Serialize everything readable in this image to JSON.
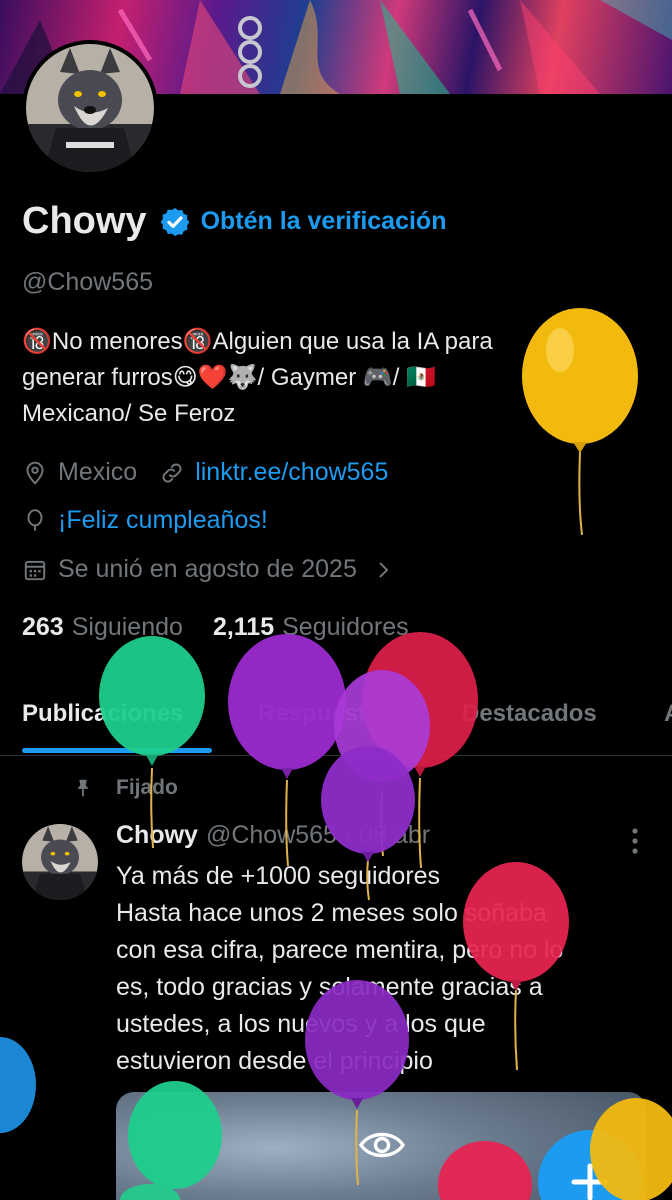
{
  "profile": {
    "name": "Chowy",
    "get_verified": "Obtén la verificación",
    "handle": "@Chow565",
    "bio_lines": [
      "🔞No menores🔞Alguien que usa la IA para",
      "generar furros😋❤️🐺/ Gaymer 🎮/ 🇲🇽",
      "Mexicano/ Se Feroz"
    ],
    "location": "Mexico",
    "link": "linktr.ee/chow565",
    "birthday": "¡Feliz cumpleaños!",
    "joined": "Se unió en agosto de 2025"
  },
  "stats": {
    "following_count": "263",
    "following_label": "Siguiendo",
    "followers_count": "2,115",
    "followers_label": "Seguidores"
  },
  "tabs": [
    {
      "label": "Publicaciones",
      "active": true
    },
    {
      "label": "Respuestas",
      "active": false
    },
    {
      "label": "Destacados",
      "active": false
    },
    {
      "label": "A",
      "active": false
    }
  ],
  "pinned_label": "Fijado",
  "post": {
    "name": "Chowy",
    "handle_time": "@Chow565 · 08 abr",
    "text_lines": [
      "Ya más de +1000 seguidores",
      "Hasta hace unos 2 meses solo soñaba",
      "con esa cifra, parece mentira, pero no lo",
      "es, todo gracias y solamente gracias a",
      "ustedes, a los nuevos y a los que",
      "estuvieron desde el principio"
    ]
  },
  "colors": {
    "accent": "#1d9bf0",
    "muted": "#71767b",
    "text": "#e7e9ea",
    "background": "#000000"
  },
  "icons": [
    "verified-badge-icon",
    "location-icon",
    "link-icon",
    "birthday-balloon-icon",
    "calendar-icon",
    "chevron-right-icon",
    "pin-icon",
    "more-vertical-icon",
    "eye-icon",
    "plus-icon"
  ]
}
